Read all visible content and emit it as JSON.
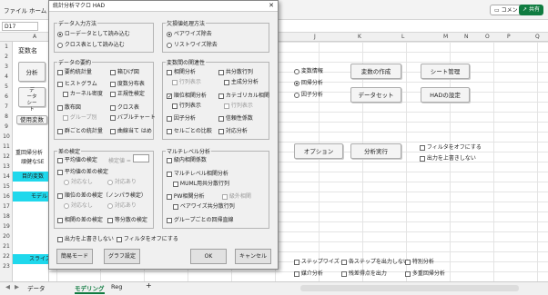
{
  "ribbon": {
    "menu": [
      "ファイル",
      "ホーム"
    ],
    "comment_label": "コメント",
    "share_label": "共有"
  },
  "formula_bar": {
    "name_box": "D17"
  },
  "grid": {
    "columns_left": [
      "A"
    ],
    "columns_right": [
      "J",
      "K",
      "L",
      "M",
      "N",
      "O",
      "P",
      "Q"
    ],
    "rows": [
      "1",
      "2",
      "3",
      "4",
      "5",
      "6",
      "7",
      "8",
      "9",
      "10",
      "11",
      "12",
      "13",
      "14",
      "15",
      "16",
      "17",
      "18",
      "19",
      "20",
      "21",
      "22",
      "23"
    ],
    "cells": {
      "var_name": "変数名",
      "analysis_btn": "分析",
      "data_btn": "デ\nータ\nシー\nト",
      "used_vars": "使用変数",
      "hint_a": "重回帰分析",
      "hint_b": "頑健なSE",
      "target_var": "目的変数",
      "model": "モデル",
      "slice": "スライス"
    },
    "right_panel": {
      "radio_variable_info": "変数情報",
      "radio_regression": "回帰分析",
      "radio_factor": "因子分析",
      "btn_make_var": "変数の作成",
      "btn_sheet_mgmt": "シート管理",
      "btn_dataset": "データセット",
      "btn_had_settings": "HADの設定",
      "btn_options": "オプション",
      "btn_run": "分析実行",
      "chk_filter_off": "フィルタをオフにする",
      "chk_no_overwrite": "出力を上書きしない",
      "chk_stepwise": "ステップワイズ",
      "chk_no_each_step": "各ステップを出力しない",
      "chk_special": "特別分析",
      "chk_mediation": "媒介分析",
      "chk_residual": "残差得点を出力",
      "chk_multi_reg": "多重回帰分析"
    }
  },
  "sheet_tabs": {
    "tabs": [
      "データ",
      "モデリング",
      "Reg"
    ],
    "add": "+"
  },
  "dialog": {
    "title": "統計分析マクロ  HAD",
    "close": "✕",
    "data_input": {
      "title": "データ入力方法",
      "opt_raw": "ローデータとして読み込む",
      "opt_cross": "クロス表として読み込む"
    },
    "missing": {
      "title": "欠損値処理方法",
      "opt_pairwise": "ペアワイズ除去",
      "opt_listwise": "リストワイズ除去"
    },
    "summary": {
      "title": "データの要約",
      "items": [
        "要約統計量",
        "箱ひげ図",
        "ヒストグラム",
        "度数分布表",
        "カーネル密度",
        "正規性検定",
        "散布図",
        "クロス表",
        "グループ別",
        "バブルチャート",
        "群ごとの統計量",
        "曲線当て はめ"
      ]
    },
    "relations": {
      "title": "変数間の関連性",
      "items": [
        "相関分析",
        "共分散行列",
        "行列表示",
        "主成分分析",
        "順位相関分析",
        "カテゴリカル相関",
        "行列表示",
        "行列表示",
        "因子分析",
        "信頼性係数",
        "セルごとの比較",
        "対応分析"
      ]
    },
    "means": {
      "title": "差の検定",
      "items": [
        "平均値の検定",
        "検定値 =",
        "平均値の差の検定",
        "対応なし",
        "対応あり",
        "順位の差の検定（ノンパラ検定）",
        "対応なし",
        "対応あり",
        "相関の差の検定",
        "等分散の検定"
      ],
      "test_value": ""
    },
    "multilevel": {
      "title": "マルチレベル分析",
      "items": [
        "級内相関係数",
        "マルチレベル相関分析",
        "MUML用共分散行列",
        "PW相関分析",
        "級外相関",
        "ペアワイズ共分散行列",
        "グループごとの回帰直線"
      ]
    },
    "bottom_checks": {
      "no_overwrite": "出力を上書きしない",
      "filter_off": "フィルタをオフにする"
    },
    "buttons": {
      "simple_mode": "簡易モード",
      "graph_settings": "グラフ設定",
      "ok": "OK",
      "cancel": "キャンセル"
    }
  },
  "colors": {
    "cyan": "#1fd8ec",
    "share_green": "#107c41"
  }
}
